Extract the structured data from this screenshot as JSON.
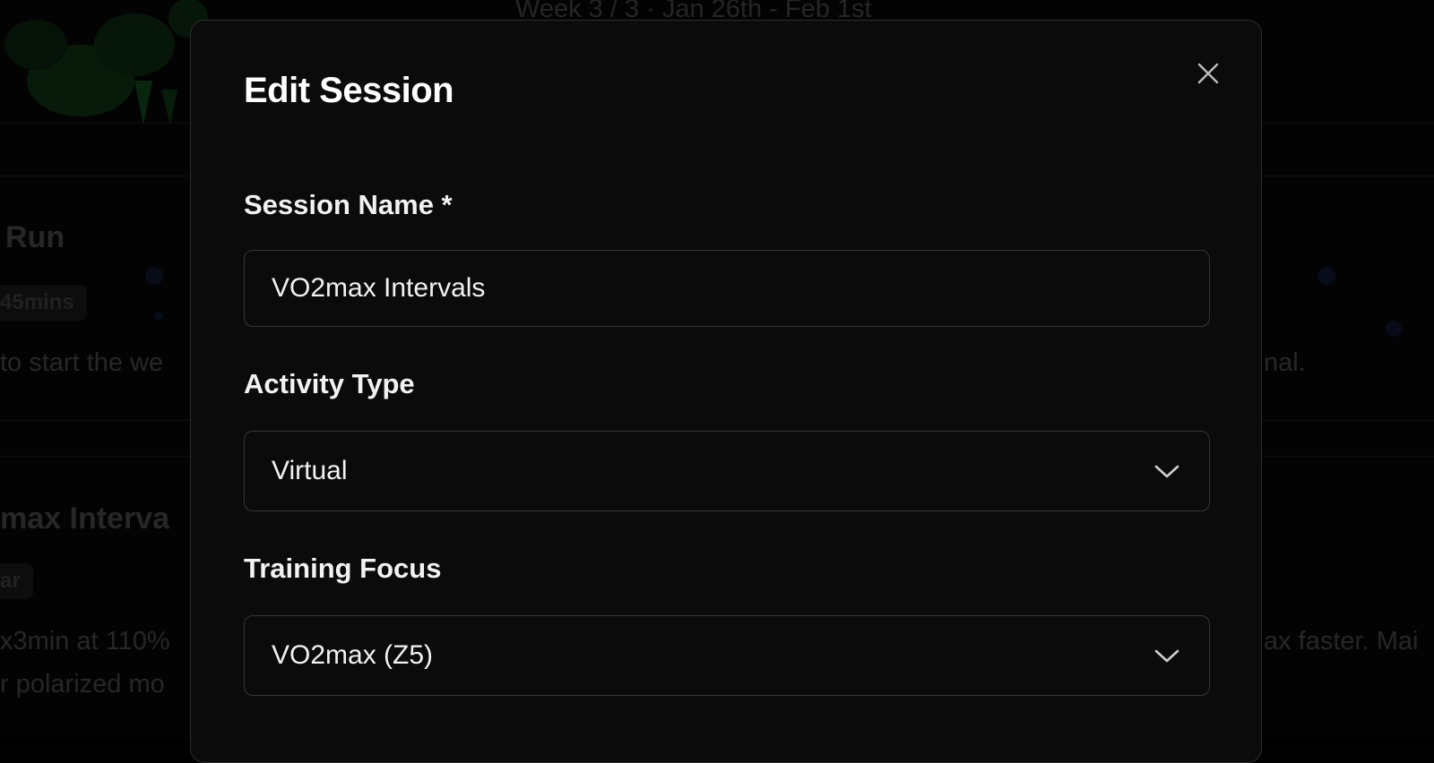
{
  "background": {
    "week_header": "Week 3 / 3 · Jan 26th - Feb 1st",
    "cards": [
      {
        "title_fragment": "Run",
        "badge_fragment": "45mins",
        "desc_left_fragment": "to start the we",
        "desc_right_fragment": "nal."
      },
      {
        "title_fragment": "max Interva",
        "badge_fragment": "ar",
        "desc_left_fragment_1": "x3min at 110%",
        "desc_left_fragment_2": "r polarized mo",
        "desc_right_fragment": "ax faster. Mai"
      }
    ]
  },
  "modal": {
    "title": "Edit Session",
    "close_icon": "close-icon",
    "fields": {
      "session_name": {
        "label": "Session Name *",
        "value": "VO2max Intervals"
      },
      "activity_type": {
        "label": "Activity Type",
        "selected": "Virtual",
        "icon": "chevron-down-icon"
      },
      "training_focus": {
        "label": "Training Focus",
        "selected": "VO2max (Z5)",
        "icon": "chevron-down-icon"
      }
    }
  },
  "colors": {
    "modal_bg": "#0b0b0b",
    "border": "#363636",
    "text": "#f2f2f2",
    "accent_green": "#0f3a16"
  }
}
